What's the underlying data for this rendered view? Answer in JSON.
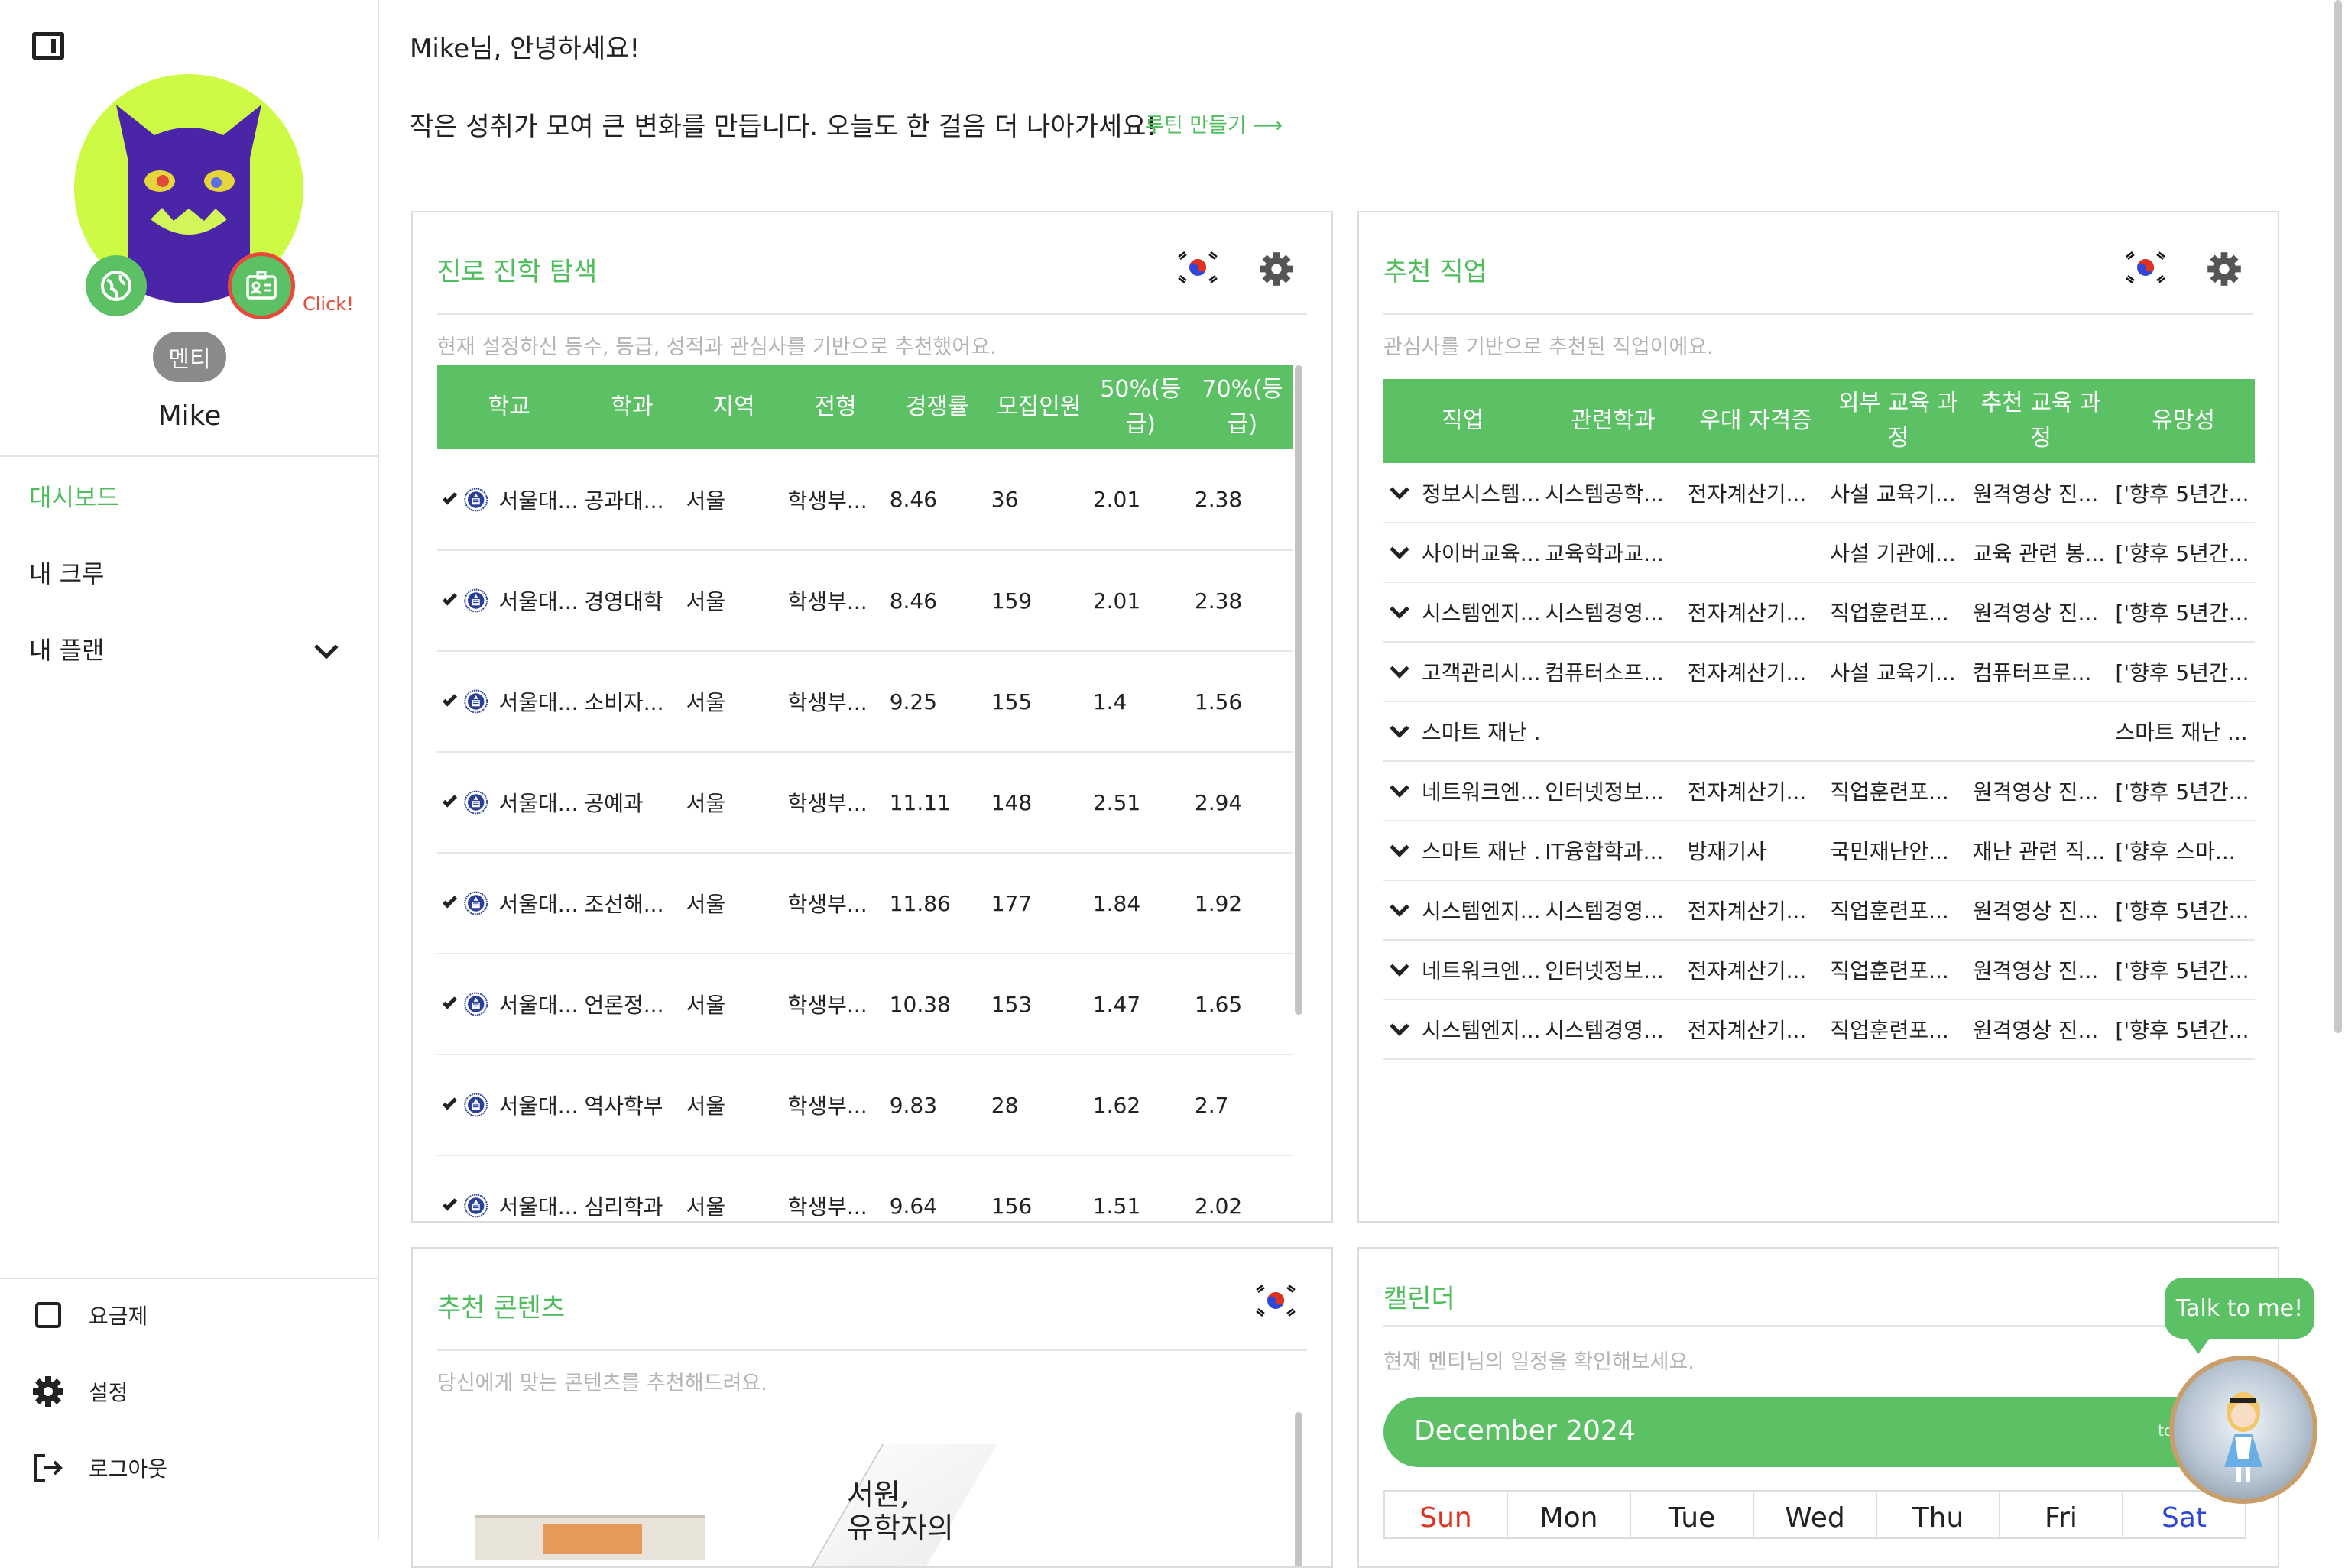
{
  "sidebar": {
    "click_hint": "Click!",
    "role": "멘티",
    "user_name": "Mike",
    "nav": [
      "대시보드",
      "내 크루",
      "내 플랜"
    ],
    "bottom": [
      "요금제",
      "설정",
      "로그아웃"
    ]
  },
  "header": {
    "greeting": "Mike님, 안녕하세요!",
    "motto": "작은 성취가 모여 큰 변화를 만듭니다. 오늘도 한 걸음 더 나아가세요!",
    "routine_link": "루틴 만들기 ⟶"
  },
  "career": {
    "title": "진로 진학 탐색",
    "subtitle": "현재 설정하신 등수, 등급, 성적과 관심사를 기반으로 추천했어요.",
    "columns": [
      "학교",
      "학과",
      "지역",
      "전형",
      "경쟁률",
      "모집인원",
      "50%(등급)",
      "70%(등급)"
    ],
    "rows": [
      {
        "school": "서울대...",
        "dept": "공과대...",
        "region": "서울",
        "type": "학생부...",
        "rate": "8.46",
        "quota": "36",
        "p50": "2.01",
        "p70": "2.38"
      },
      {
        "school": "서울대...",
        "dept": "경영대학",
        "region": "서울",
        "type": "학생부...",
        "rate": "8.46",
        "quota": "159",
        "p50": "2.01",
        "p70": "2.38"
      },
      {
        "school": "서울대...",
        "dept": "소비자...",
        "region": "서울",
        "type": "학생부...",
        "rate": "9.25",
        "quota": "155",
        "p50": "1.4",
        "p70": "1.56"
      },
      {
        "school": "서울대...",
        "dept": "공예과",
        "region": "서울",
        "type": "학생부...",
        "rate": "11.11",
        "quota": "148",
        "p50": "2.51",
        "p70": "2.94"
      },
      {
        "school": "서울대...",
        "dept": "조선해...",
        "region": "서울",
        "type": "학생부...",
        "rate": "11.86",
        "quota": "177",
        "p50": "1.84",
        "p70": "1.92"
      },
      {
        "school": "서울대...",
        "dept": "언론정...",
        "region": "서울",
        "type": "학생부...",
        "rate": "10.38",
        "quota": "153",
        "p50": "1.47",
        "p70": "1.65"
      },
      {
        "school": "서울대...",
        "dept": "역사학부",
        "region": "서울",
        "type": "학생부...",
        "rate": "9.83",
        "quota": "28",
        "p50": "1.62",
        "p70": "2.7"
      },
      {
        "school": "서울대...",
        "dept": "심리학과",
        "region": "서울",
        "type": "학생부...",
        "rate": "9.64",
        "quota": "156",
        "p50": "1.51",
        "p70": "2.02"
      }
    ]
  },
  "jobs": {
    "title": "추천 직업",
    "subtitle": "관심사를 기반으로 추천된 직업이에요.",
    "columns": [
      "직업",
      "관련학과",
      "우대 자격증",
      "외부 교육 과정",
      "추천 교육 과정",
      "유망성"
    ],
    "rows": [
      [
        "정보시스템...",
        "시스템공학...",
        "전자계산기...",
        "사설 교육기...",
        "원격영상 진...",
        "['향후 5년간..."
      ],
      [
        "사이버교육...",
        "교육학과교...",
        "",
        "사설 기관에...",
        "교육 관련 봉...",
        "['향후 5년간..."
      ],
      [
        "시스템엔지...",
        "시스템경영...",
        "전자계산기...",
        "직업훈련포...",
        "원격영상 진...",
        "['향후 5년간..."
      ],
      [
        "고객관리시...",
        "컴퓨터소프...",
        "전자계산기...",
        "사설 교육기...",
        "컴퓨터프로...",
        "['향후 5년간..."
      ],
      [
        "스마트 재난 ...",
        "",
        "",
        "",
        "",
        "스마트 재난 ..."
      ],
      [
        "네트워크엔...",
        "인터넷정보...",
        "전자계산기...",
        "직업훈련포...",
        "원격영상 진...",
        "['향후 5년간..."
      ],
      [
        "스마트 재난 ...",
        "IT융합학과...",
        "방재기사",
        "국민재난안...",
        "재난 관련 직...",
        "['향후 스마..."
      ],
      [
        "시스템엔지...",
        "시스템경영...",
        "전자계산기...",
        "직업훈련포...",
        "원격영상 진...",
        "['향후 5년간..."
      ],
      [
        "네트워크엔...",
        "인터넷정보...",
        "전자계산기...",
        "직업훈련포...",
        "원격영상 진...",
        "['향후 5년간..."
      ],
      [
        "시스템엔지...",
        "시스템경영...",
        "전자계산기...",
        "직업훈련포...",
        "원격영상 진...",
        "['향후 5년간..."
      ]
    ]
  },
  "content": {
    "title": "추천 콘텐츠",
    "subtitle": "당신에게 맞는 콘텐츠를 추천해드려요.",
    "book_text": "서원,\n유학자의"
  },
  "calendar": {
    "title": "캘린더",
    "subtitle": "현재 멘티님의 일정을 확인해보세요.",
    "month": "December 2024",
    "today": "today",
    "days": [
      "Sun",
      "Mon",
      "Tue",
      "Wed",
      "Thu",
      "Fri",
      "Sat"
    ]
  },
  "chat": {
    "label": "Talk to me!"
  },
  "colors": {
    "accent": "#5bc164",
    "accent_text": "#4fbd5b",
    "alert": "#e84a3a",
    "sunday": "#e0301e",
    "saturday": "#2f47d8"
  }
}
